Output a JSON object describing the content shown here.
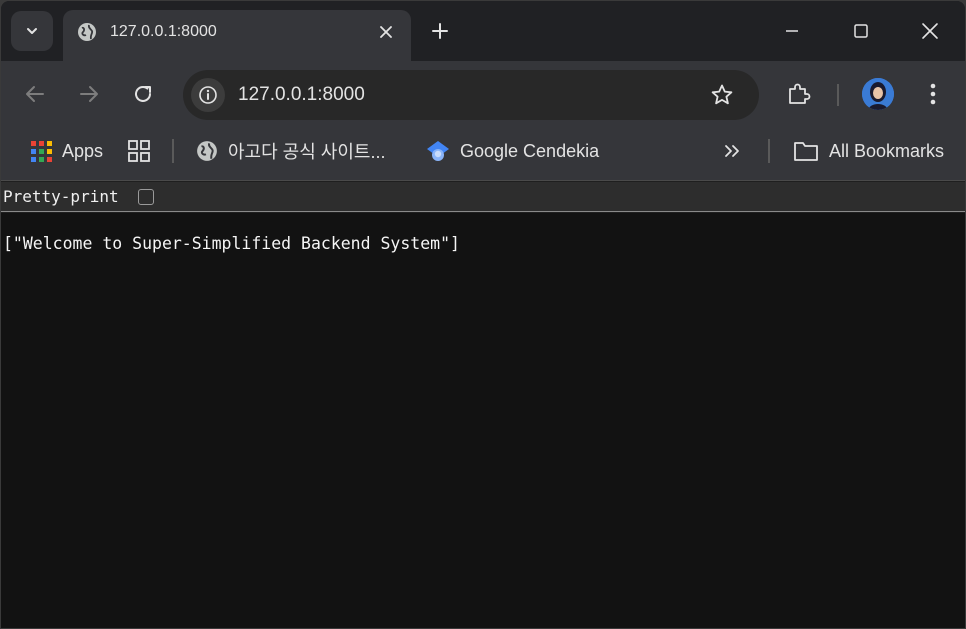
{
  "tab": {
    "title": "127.0.0.1:8000",
    "close_icon": "close-icon"
  },
  "toolbar": {
    "url": "127.0.0.1:8000"
  },
  "bookmarks": {
    "apps_label": "Apps",
    "site_label": "아고다 공식 사이트...",
    "cendekia_label": "Google Cendekia",
    "all_label": "All Bookmarks"
  },
  "pretty_print": {
    "label": "Pretty-print",
    "checked": false
  },
  "content": {
    "json_text": "[\"Welcome to Super-Simplified Backend System\"]"
  },
  "colors": {
    "accent": "#8ab4f8",
    "background": "#121212",
    "toolbar": "#35363a"
  }
}
